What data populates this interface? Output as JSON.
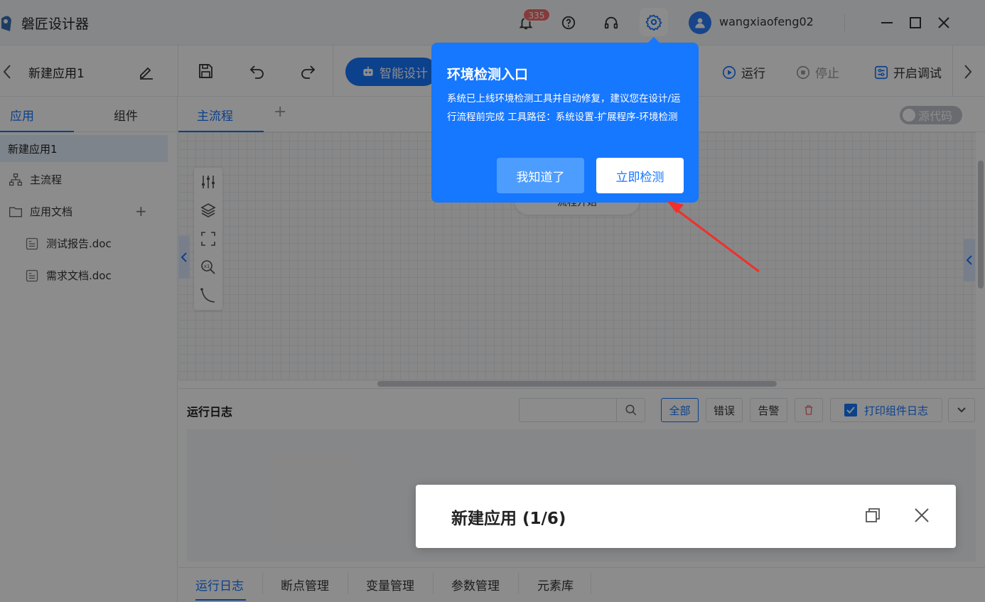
{
  "titlebar": {
    "app_title": "磐匠设计器",
    "notification_count": "335",
    "username": "wangxiaofeng02"
  },
  "toolbar": {
    "app_name": "新建应用1",
    "smart_design_label": "智能设计",
    "run_label": "运行",
    "stop_label": "停止",
    "debug_label": "开启调试"
  },
  "sidebar": {
    "tabs": [
      "应用",
      "组件"
    ],
    "root": "新建应用1",
    "items": [
      {
        "label": "主流程",
        "icon": "flow-icon"
      },
      {
        "label": "应用文档",
        "icon": "folder-icon"
      },
      {
        "label": "测试报告.doc",
        "icon": "doc-icon"
      },
      {
        "label": "需求文档.doc",
        "icon": "doc-icon"
      }
    ]
  },
  "canvas": {
    "tab_main": "主流程",
    "tab_add": "+",
    "source_toggle_label": "源代码",
    "start_node_label": "流程开始"
  },
  "log": {
    "title": "运行日志",
    "filter_all": "全部",
    "filter_error": "错误",
    "filter_warn": "告警",
    "print_label": "打印组件日志"
  },
  "bottom_tabs": [
    "运行日志",
    "断点管理",
    "变量管理",
    "参数管理",
    "元素库"
  ],
  "notify": {
    "title": "新建应用 (1/6)"
  },
  "popover": {
    "title": "环境检测入口",
    "body": "系统已上线环境检测工具并自动修复，建议您在设计/运行流程前完成 工具路径：系统设置-扩展程序-环境检测",
    "later_label": "我知道了",
    "check_label": "立即检测"
  },
  "colors": {
    "accent": "#1677ff",
    "badge": "#f56c6c",
    "arrow": "#f0302a"
  }
}
